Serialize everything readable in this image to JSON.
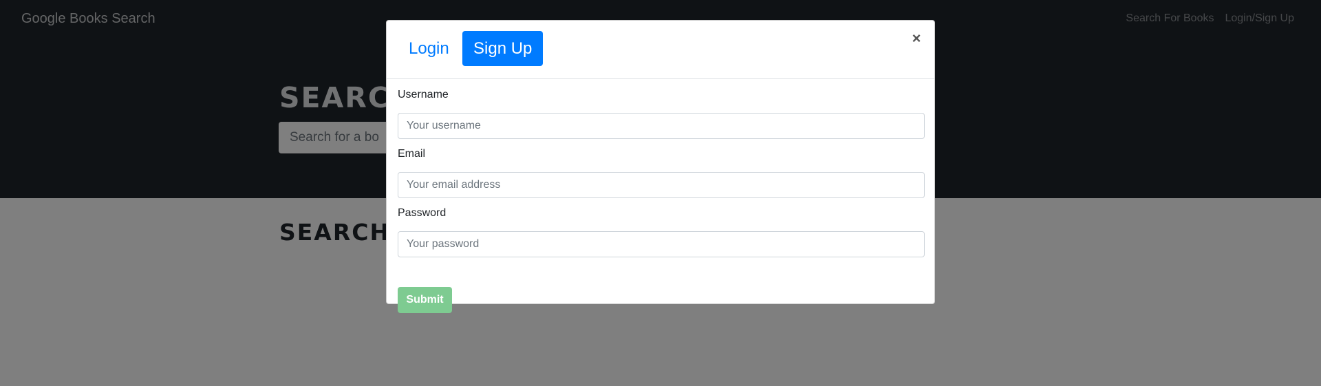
{
  "navbar": {
    "brand": "Google Books Search",
    "links": [
      "Search For Books",
      "Login/Sign Up"
    ]
  },
  "hero": {
    "title": "SEARC",
    "search_placeholder": "Search for a bo"
  },
  "results": {
    "title": "SEARCH"
  },
  "modal": {
    "tabs": {
      "login": "Login",
      "signup": "Sign Up"
    },
    "active_tab": "signup",
    "close_label": "×",
    "fields": {
      "username": {
        "label": "Username",
        "placeholder": "Your username",
        "value": ""
      },
      "email": {
        "label": "Email",
        "placeholder": "Your email address",
        "value": ""
      },
      "password": {
        "label": "Password",
        "placeholder": "Your password",
        "value": ""
      }
    },
    "submit_label": "Submit"
  },
  "colors": {
    "dark_bg": "#1f242a",
    "primary": "#007bff",
    "submit_disabled": "#7ecb91"
  }
}
